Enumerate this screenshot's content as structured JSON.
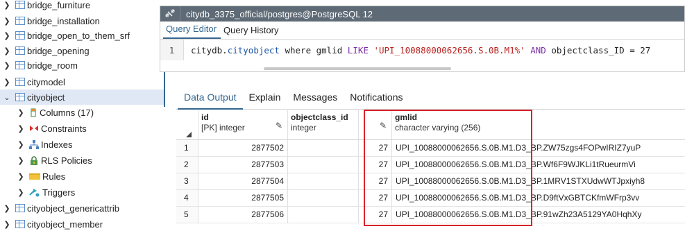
{
  "tree": {
    "items": [
      {
        "label": "bridge_furniture",
        "icon": "table-icon",
        "expanded": false,
        "indent": 0
      },
      {
        "label": "bridge_installation",
        "icon": "table-icon",
        "expanded": false,
        "indent": 0
      },
      {
        "label": "bridge_open_to_them_srf",
        "icon": "table-icon",
        "expanded": false,
        "indent": 0
      },
      {
        "label": "bridge_opening",
        "icon": "table-icon",
        "expanded": false,
        "indent": 0
      },
      {
        "label": "bridge_room",
        "icon": "table-icon",
        "expanded": false,
        "indent": 0
      },
      {
        "label": "citymodel",
        "icon": "table-icon",
        "expanded": false,
        "indent": 0
      },
      {
        "label": "cityobject",
        "icon": "table-icon",
        "expanded": true,
        "indent": 0,
        "selected": true
      },
      {
        "label": "Columns (17)",
        "icon": "columns-icon",
        "expanded": false,
        "indent": 1
      },
      {
        "label": "Constraints",
        "icon": "constraints-icon",
        "expanded": false,
        "indent": 1
      },
      {
        "label": "Indexes",
        "icon": "indexes-icon",
        "expanded": false,
        "indent": 1
      },
      {
        "label": "RLS Policies",
        "icon": "rls-policies-icon",
        "expanded": false,
        "indent": 1
      },
      {
        "label": "Rules",
        "icon": "rules-icon",
        "expanded": false,
        "indent": 1
      },
      {
        "label": "Triggers",
        "icon": "triggers-icon",
        "expanded": false,
        "indent": 1
      },
      {
        "label": "cityobject_genericattrib",
        "icon": "table-icon",
        "expanded": false,
        "indent": 0
      },
      {
        "label": "cityobject_member",
        "icon": "table-icon",
        "expanded": false,
        "indent": 0
      }
    ]
  },
  "query_window": {
    "title": "citydb_3375_official/postgres@PostgreSQL 12",
    "tabs": [
      {
        "label": "Query Editor",
        "active": true
      },
      {
        "label": "Query History",
        "active": false
      }
    ],
    "line_number": "1",
    "sql": {
      "t1": "citydb.",
      "t2": "cityobject",
      "t3": " where gmlid ",
      "t4": "LIKE",
      "t5": " ",
      "t6": "'UPI_10088000062656.S.0B.M1%'",
      "t7": " ",
      "t8": "AND",
      "t9": " objectclass_ID = 27"
    }
  },
  "result_panel": {
    "tabs": [
      {
        "label": "Data Output",
        "active": true
      },
      {
        "label": "Explain",
        "active": false
      },
      {
        "label": "Messages",
        "active": false
      },
      {
        "label": "Notifications",
        "active": false
      }
    ],
    "columns": [
      {
        "name": "id",
        "type": "[PK] integer"
      },
      {
        "name": "objectclass_id",
        "type": "integer"
      },
      {
        "name": "gmlid",
        "type": "character varying (256)"
      }
    ],
    "rows": [
      {
        "n": "1",
        "id": "2877502",
        "objectclass_id": "",
        "oc": "27",
        "gmlid": "UPI_10088000062656.S.0B.M1.D3_BP.ZW75zgs4FOPwIRIZ7yuP"
      },
      {
        "n": "2",
        "id": "2877503",
        "objectclass_id": "",
        "oc": "27",
        "gmlid": "UPI_10088000062656.S.0B.M1.D3_BP.Wf6F9WJKLi1tRueurmVi"
      },
      {
        "n": "3",
        "id": "2877504",
        "objectclass_id": "",
        "oc": "27",
        "gmlid": "UPI_10088000062656.S.0B.M1.D3_BP.1MRV1STXUdwWTJpxiyh8"
      },
      {
        "n": "4",
        "id": "2877505",
        "objectclass_id": "",
        "oc": "27",
        "gmlid": "UPI_10088000062656.S.0B.M1.D3_BP.D9ftVxGBTCKfmWFrp3vv"
      },
      {
        "n": "5",
        "id": "2877506",
        "objectclass_id": "",
        "oc": "27",
        "gmlid": "UPI_10088000062656.S.0B.M1.D3_BP.91wZh23A5129YA0HqhXy"
      }
    ]
  },
  "colors": {
    "accent": "#326690",
    "titlebar": "#5e6a75",
    "highlight_box": "#d9232a"
  }
}
